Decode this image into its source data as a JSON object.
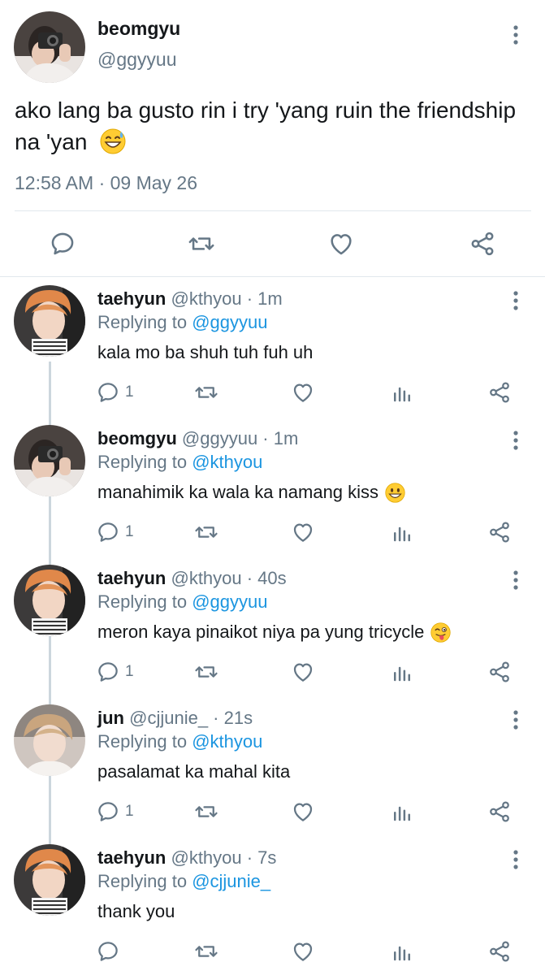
{
  "colors": {
    "text": "#14171a",
    "secondary": "#657786",
    "link": "#1b95e0",
    "divider": "#e1e8ed",
    "thread_line": "#ccd6dd"
  },
  "main_tweet": {
    "name": "beomgyu",
    "handle": "@ggyyuu",
    "text": "ako lang ba gusto rin i try 'yang ruin the friendship na 'yan",
    "emoji": "grinning-sweat-emoji",
    "timestamp": "12:58 AM · 09 May 26",
    "actions": [
      "reply-icon",
      "retweet-icon",
      "like-icon",
      "share-icon"
    ]
  },
  "replies": [
    {
      "name": "taehyun",
      "meta": "@kthyou · 1m",
      "replying_prefix": "Replying to",
      "replying_to": "@ggyyuu",
      "text": "kala mo ba shuh tuh fuh uh",
      "emoji": "",
      "reply_count": "1"
    },
    {
      "name": "beomgyu",
      "meta": "@ggyyuu · 1m",
      "replying_prefix": "Replying to",
      "replying_to": "@kthyou",
      "text": "manahimik ka wala ka namang kiss",
      "emoji": "grinning-emoji",
      "reply_count": "1"
    },
    {
      "name": "taehyun",
      "meta": "@kthyou · 40s",
      "replying_prefix": "Replying to",
      "replying_to": "@ggyyuu",
      "text": "meron kaya pinaikot niya pa yung tricycle",
      "emoji": "winking-tongue-emoji",
      "reply_count": "1"
    },
    {
      "name": "jun",
      "meta": "@cjjunie_ · 21s",
      "replying_prefix": "Replying to",
      "replying_to": "@kthyou",
      "text": "pasalamat ka mahal kita",
      "emoji": "",
      "reply_count": "1"
    },
    {
      "name": "taehyun",
      "meta": "@kthyou · 7s",
      "replying_prefix": "Replying to",
      "replying_to": "@cjjunie_",
      "text": "thank you",
      "emoji": "",
      "reply_count": ""
    }
  ]
}
